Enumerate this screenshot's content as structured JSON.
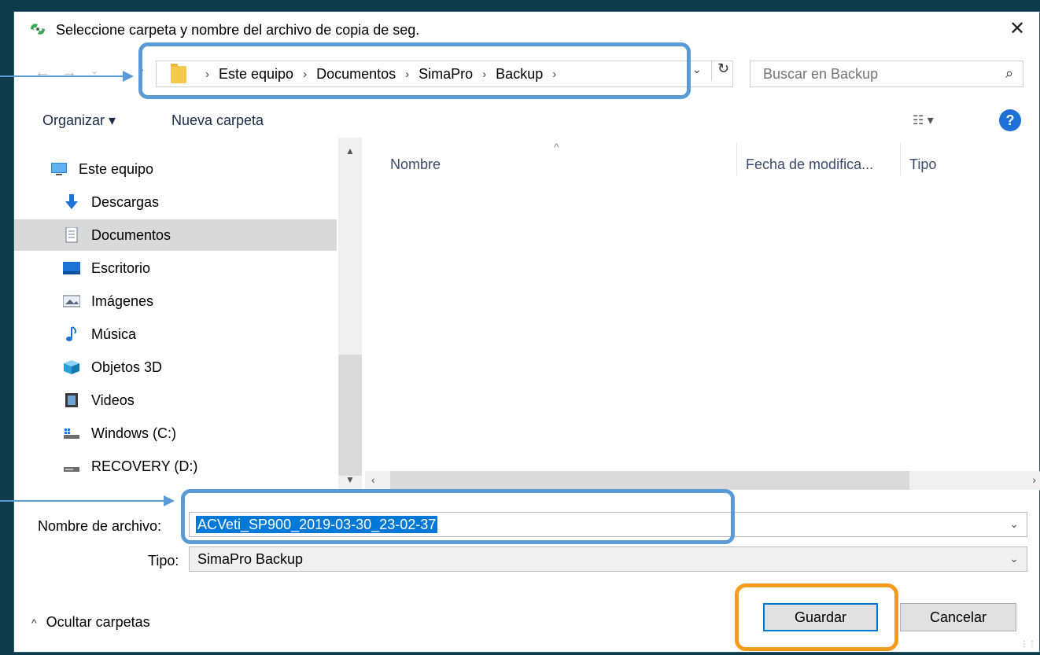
{
  "dialog": {
    "title": "Seleccione carpeta y nombre del archivo de copia de seg.",
    "close_glyph": "✕"
  },
  "nav": {
    "back_glyph": "←",
    "forward_glyph": "→",
    "recent_glyph": "⌄",
    "up_glyph": "↑",
    "breadcrumbs": [
      "Este equipo",
      "Documentos",
      "SimaPro",
      "Backup"
    ],
    "sep_glyph": "›",
    "dropdown_glyph": "⌄",
    "refresh_glyph": "↻",
    "search_placeholder": "Buscar en Backup",
    "search_glyph": "⌕"
  },
  "toolbar": {
    "organize_label": "Organizar ▾",
    "new_folder_label": "Nueva carpeta",
    "view_glyph": "☷ ▾",
    "help_glyph": "?"
  },
  "sidebar": {
    "items": [
      {
        "label": "Este equipo",
        "icon": "computer-icon",
        "selected": false
      },
      {
        "label": "Descargas",
        "icon": "download-icon",
        "selected": false
      },
      {
        "label": "Documentos",
        "icon": "document-icon",
        "selected": true
      },
      {
        "label": "Escritorio",
        "icon": "desktop-icon",
        "selected": false
      },
      {
        "label": "Imágenes",
        "icon": "pictures-icon",
        "selected": false
      },
      {
        "label": "Música",
        "icon": "music-icon",
        "selected": false
      },
      {
        "label": "Objetos 3D",
        "icon": "3d-objects-icon",
        "selected": false
      },
      {
        "label": "Videos",
        "icon": "videos-icon",
        "selected": false
      },
      {
        "label": "Windows (C:)",
        "icon": "drive-c-icon",
        "selected": false
      },
      {
        "label": "RECOVERY (D:)",
        "icon": "drive-d-icon",
        "selected": false
      }
    ]
  },
  "columns": {
    "name": "Nombre",
    "modified": "Fecha de modifica...",
    "type": "Tipo",
    "sort_glyph": "^"
  },
  "form": {
    "filename_label": "Nombre de archivo:",
    "filename_value": "ACVeti_SP900_2019-03-30_23-02-37",
    "type_label": "Tipo:",
    "type_value": "SimaPro Backup",
    "caret": "⌄"
  },
  "footer": {
    "hide_folders_label": "Ocultar carpetas",
    "hide_caret": "^",
    "save_label": "Guardar",
    "cancel_label": "Cancelar"
  },
  "colors": {
    "background": "#0e3a4c",
    "highlight_blue": "#5b9bd5",
    "highlight_orange": "#f39c1e",
    "selection_blue": "#0078d7"
  }
}
